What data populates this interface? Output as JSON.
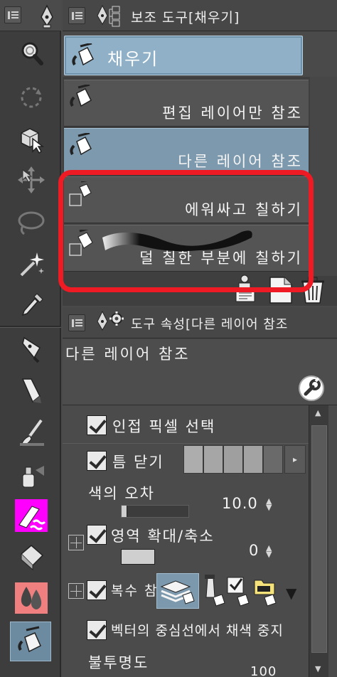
{
  "subtool_panel": {
    "title": "보조 도구[채우기]",
    "group_tab_label": "채우기",
    "items": [
      {
        "label": "편집 레이어만 참조",
        "selected": false
      },
      {
        "label": "다른 레이어 참조",
        "selected": true
      },
      {
        "label": "에워싸고 칠하기",
        "selected": false
      },
      {
        "label": "덜 칠한 부분에 칠하기",
        "selected": false
      }
    ]
  },
  "property_panel": {
    "title": "도구 속성[다른 레이어 참조",
    "preset_name": "다른 레이어 참조",
    "properties": {
      "adjacent_pixels": {
        "label": "인접 픽셀 선택",
        "checked": true
      },
      "close_gap": {
        "label": "틈 닫기",
        "checked": true
      },
      "color_margin": {
        "label": "색의 오차",
        "value": "10.0"
      },
      "area_scaling": {
        "label": "영역 확대/축소",
        "checked": true,
        "value": "0"
      },
      "multiple_referencing": {
        "label": "복수 참",
        "checked": true
      },
      "vector_stop": {
        "label": "벡터의 중심선에서 채색 중지",
        "checked": true
      },
      "opacity": {
        "label": "불투명도",
        "value": "100"
      }
    }
  },
  "colors": {
    "panel_bg": "#4a4a4a",
    "selected_item": "#7d99ad",
    "annotation_red": "#ee1b24",
    "magenta_tool": "#ff00ff",
    "pink_tool": "#f07f7f"
  },
  "toolbar_icons": [
    "zoom-icon",
    "rotate-icon",
    "object-select-icon",
    "move-layer-icon",
    "lasso-icon",
    "auto-select-wand-icon",
    "eyedropper-icon",
    "pen-icon",
    "pencil-icon",
    "brush-icon",
    "airbrush-icon",
    "decoration-icon",
    "eraser-icon",
    "blend-icon",
    "fill-icon"
  ]
}
